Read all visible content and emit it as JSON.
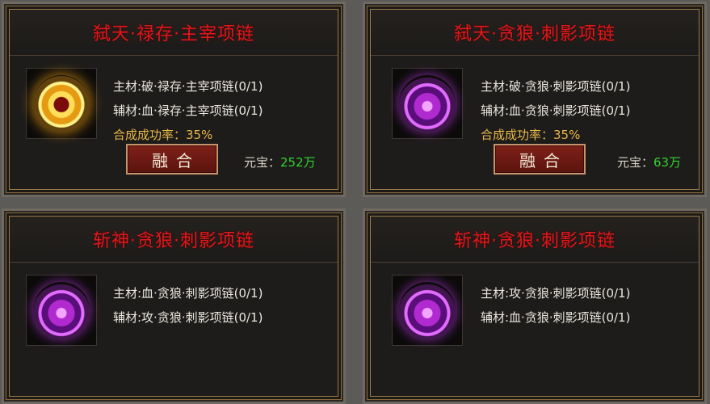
{
  "panels": [
    {
      "title": "弑天·禄存·主宰项链",
      "main_material": "主材:破·禄存·主宰项链(0/1)",
      "aux_material": "辅材:血·禄存·主宰项链(0/1)",
      "success_rate": "合成成功率：35%",
      "fuse_label": "融合",
      "ingot_label": "元宝：",
      "ingot_value": "252万",
      "icon": "gold-necklace-icon"
    },
    {
      "title": "弑天·贪狼·刺影项链",
      "main_material": "主材:破·贪狼·刺影项链(0/1)",
      "aux_material": "辅材:血·贪狼·刺影项链(0/1)",
      "success_rate": "合成成功率：35%",
      "fuse_label": "融合",
      "ingot_label": "元宝：",
      "ingot_value": "63万",
      "icon": "purple-necklace-icon"
    },
    {
      "title": "斩神·贪狼·刺影项链",
      "main_material": "主材:血·贪狼·刺影项链(0/1)",
      "aux_material": "辅材:攻·贪狼·刺影项链(0/1)",
      "icon": "purple-necklace-icon"
    },
    {
      "title": "斩神·贪狼·刺影项链",
      "main_material": "主材:攻·贪狼·刺影项链(0/1)",
      "aux_material": "辅材:血·贪狼·刺影项链(0/1)",
      "icon": "purple-necklace-icon"
    }
  ],
  "colors": {
    "title_red": "#e0181c",
    "rate_gold": "#e8b74a",
    "ingot_green": "#2fd32f"
  }
}
